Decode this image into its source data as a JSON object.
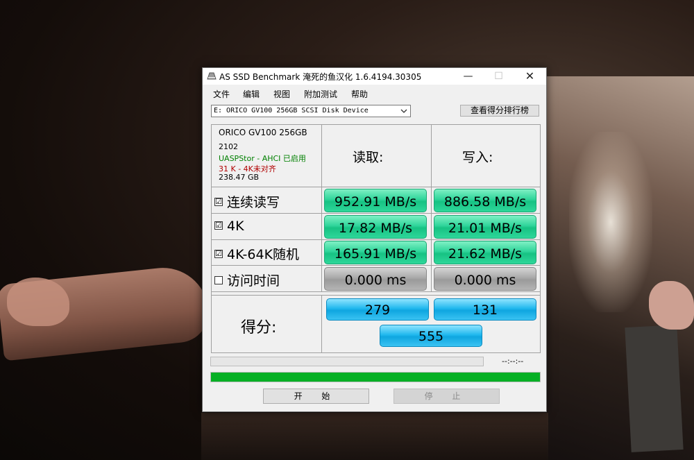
{
  "window": {
    "title": "AS SSD Benchmark 淹死的鱼汉化 1.6.4194.30305",
    "minimize": "—",
    "maximize": "☐",
    "close": "✕"
  },
  "menu": [
    "文件",
    "编辑",
    "视图",
    "附加测试",
    "帮助"
  ],
  "drive_select": {
    "value": "E: ORICO GV100 256GB SCSI Disk Device"
  },
  "rank_button": "查看得分排行榜",
  "drive_info": {
    "name": "ORICO GV100 256GB",
    "firmware": "2102",
    "driver": "UASPStor - AHCI 已启用",
    "alignment": "31 K - 4K未对齐",
    "size": "238.47 GB",
    "driver_color": "#008000",
    "alignment_color": "#b00000"
  },
  "headers": {
    "read": "读取:",
    "write": "写入:"
  },
  "rows": [
    {
      "label": "连续读写",
      "checked": "☑",
      "read": "952.91 MB/s",
      "write": "886.58 MB/s"
    },
    {
      "label": "4K",
      "checked": "☑",
      "read": "17.82 MB/s",
      "write": "21.01 MB/s"
    },
    {
      "label": "4K-64K随机",
      "checked": "☑",
      "read": "165.91 MB/s",
      "write": "21.62 MB/s"
    },
    {
      "label": "访问时间",
      "checked": "",
      "read": "0.000 ms",
      "write": "0.000 ms"
    }
  ],
  "score": {
    "label": "得分:",
    "read": "279",
    "write": "131",
    "total": "555"
  },
  "progress": {
    "time": "--:--:--",
    "value": 1.0
  },
  "buttons": {
    "start": "开 始",
    "stop": "停 止"
  },
  "colors": {
    "result_green": "#17c283",
    "score_blue": "#0fa6e0",
    "progress_green": "#06b025"
  }
}
